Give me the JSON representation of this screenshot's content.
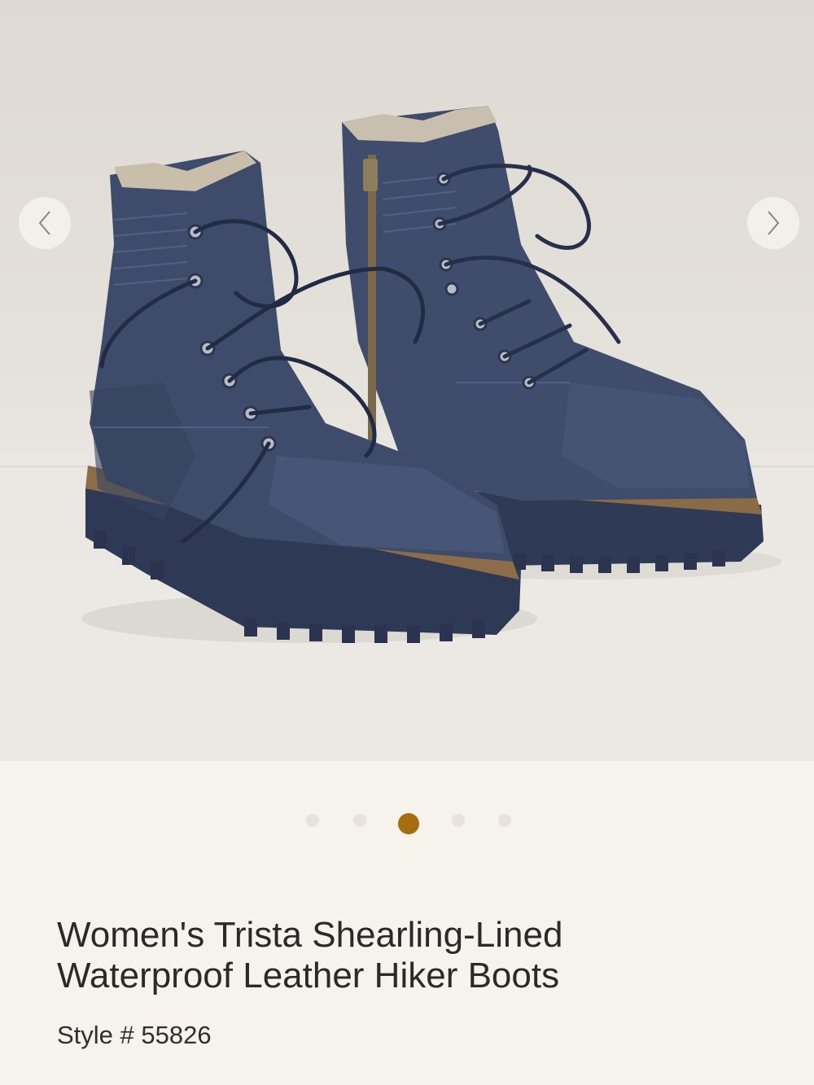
{
  "gallery": {
    "image_alt": "Navy blue shearling-lined leather hiker boots",
    "prev_icon": "chevron-left-icon",
    "next_icon": "chevron-right-icon",
    "slide_count": 5,
    "active_slide": 3
  },
  "product": {
    "title_line1": "Women's Trista Shearling-Lined",
    "title_line2": "Waterproof Leather Hiker Boots",
    "style_label": "Style #",
    "style_number": "55826"
  },
  "colors": {
    "accent": "#a46d10",
    "background": "#f6f2ec",
    "boot": "#3d4a6a"
  }
}
